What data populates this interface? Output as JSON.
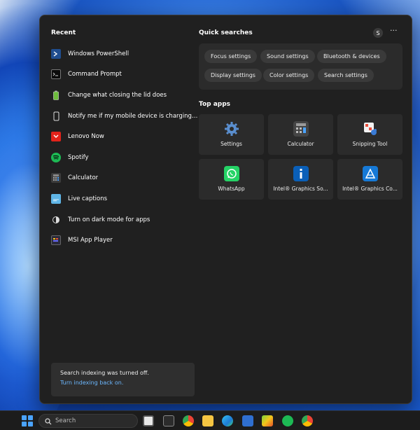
{
  "recent": {
    "title": "Recent",
    "items": [
      {
        "label": "Windows PowerShell",
        "icon": "powershell-icon"
      },
      {
        "label": "Command Prompt",
        "icon": "command-prompt-icon"
      },
      {
        "label": "Change what closing the lid does",
        "icon": "battery-icon"
      },
      {
        "label": "Notify me if my mobile device is charging ...",
        "icon": "phone-icon"
      },
      {
        "label": "Lenovo Now",
        "icon": "lenovo-now-icon"
      },
      {
        "label": "Spotify",
        "icon": "spotify-icon"
      },
      {
        "label": "Calculator",
        "icon": "calculator-icon"
      },
      {
        "label": "Live captions",
        "icon": "live-captions-icon"
      },
      {
        "label": "Turn on dark mode for apps",
        "icon": "dark-mode-icon"
      },
      {
        "label": "MSI App Player",
        "icon": "msi-app-player-icon"
      }
    ]
  },
  "quick_searches": {
    "title": "Quick searches",
    "avatar_letter": "S",
    "more_label": "···",
    "chips": [
      {
        "label": "Focus settings"
      },
      {
        "label": "Sound settings"
      },
      {
        "label": "Bluetooth & devices"
      },
      {
        "label": "Display settings"
      },
      {
        "label": "Color settings"
      },
      {
        "label": "Search settings"
      }
    ]
  },
  "top_apps": {
    "title": "Top apps",
    "apps": [
      {
        "label": "Settings",
        "icon": "settings-gear-icon"
      },
      {
        "label": "Calculator",
        "icon": "calculator-icon"
      },
      {
        "label": "Snipping Tool",
        "icon": "snipping-tool-icon"
      },
      {
        "label": "WhatsApp",
        "icon": "whatsapp-icon"
      },
      {
        "label": "Intel® Graphics So...",
        "icon": "intel-graphics-software-icon"
      },
      {
        "label": "Intel® Graphics Co...",
        "icon": "intel-graphics-command-icon"
      }
    ]
  },
  "notice": {
    "text": "Search indexing was turned off.",
    "link": "Turn indexing back on."
  },
  "taskbar": {
    "search_placeholder": "Search"
  },
  "colors": {
    "panel_bg": "#202020",
    "tile_bg": "#2b2b2b",
    "chip_bg": "#3a3a3a",
    "link": "#6cb8ff",
    "accent": "#4aa3ff"
  }
}
